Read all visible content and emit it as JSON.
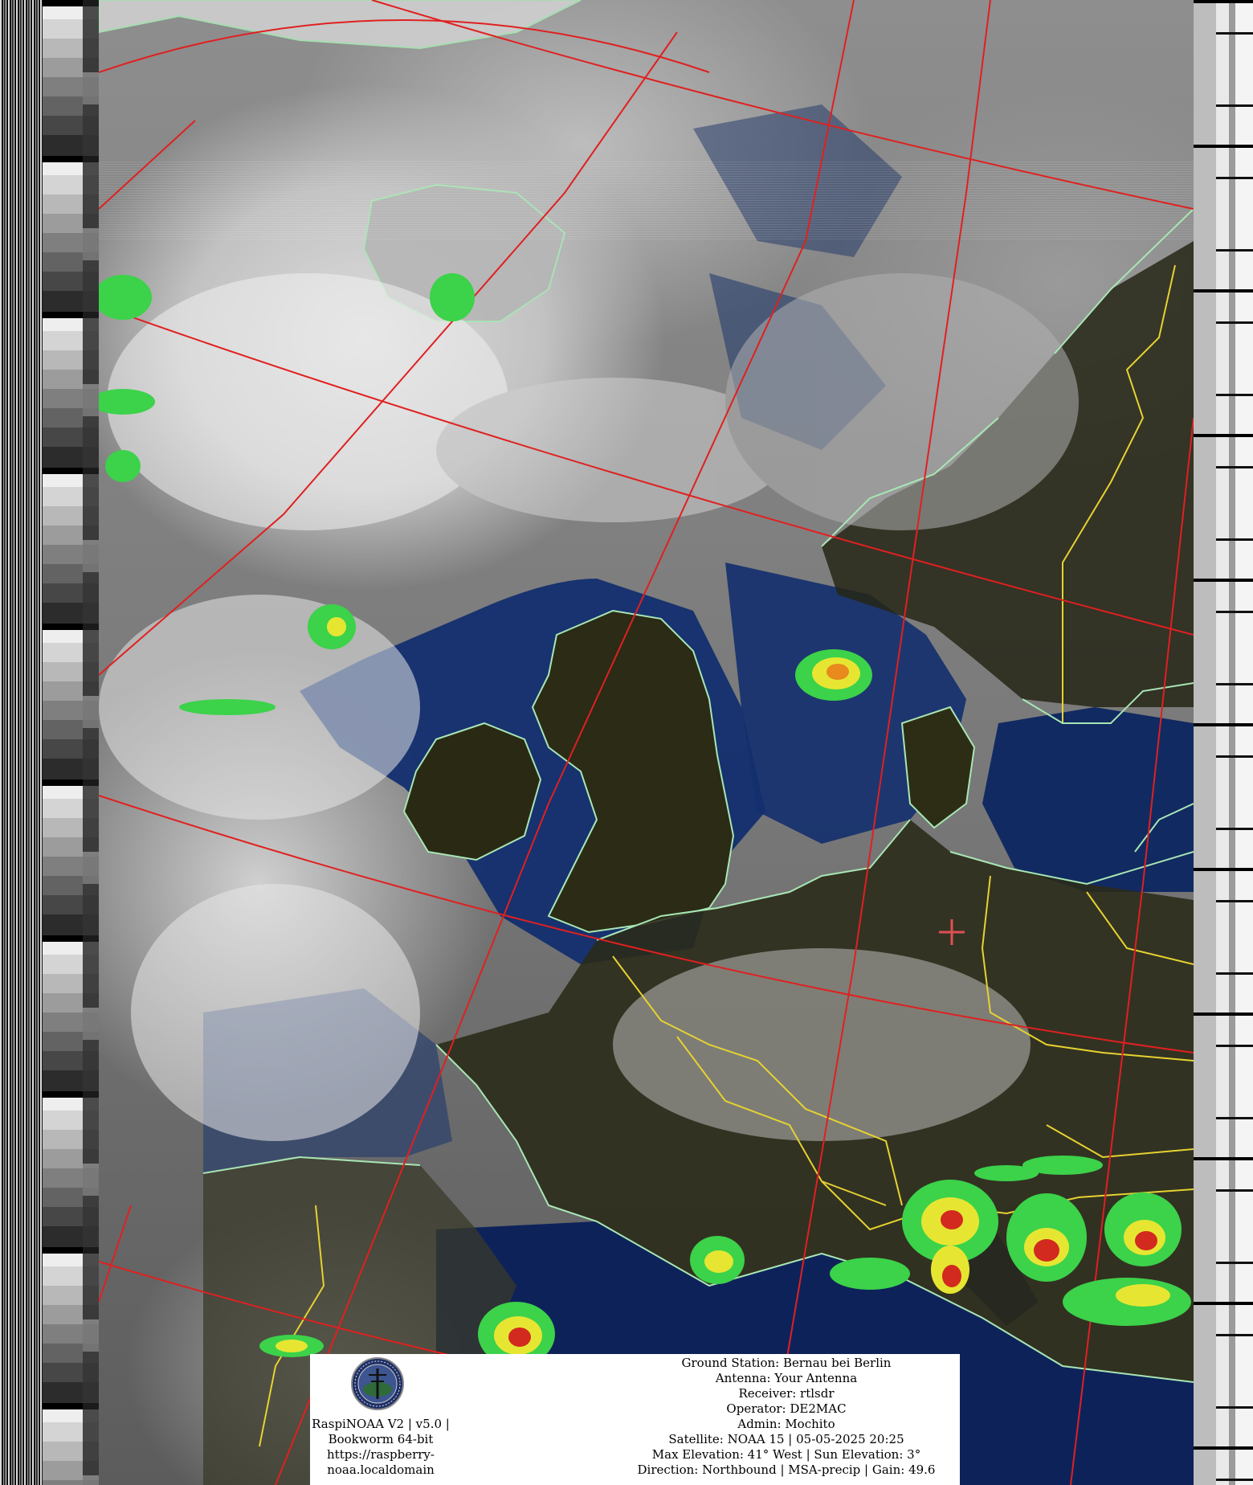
{
  "image": {
    "subject": "NOAA 15 APT weather satellite image of Western Europe with MSA-precip enhancement",
    "colors": {
      "grid_lines": "#e02020",
      "coastlines": "#a8e6b4",
      "borders": "#e6d230",
      "sea": "#0d2a66",
      "land": "#2a2a12",
      "precip_light": "#3cd24a",
      "precip_medium": "#e6e632",
      "precip_heavy": "#d22a1e",
      "station_marker": "#e05050"
    }
  },
  "footer": {
    "logo_name": "raspinoaa-logo",
    "project_lines": [
      "RaspiNOAA V2 | v5.0 |",
      "Bookworm 64-bit",
      "https://raspberry-",
      "noaa.localdomain"
    ],
    "pass_info": [
      "Ground Station: Bernau bei Berlin",
      "Antenna: Your Antenna",
      "Receiver: rtlsdr",
      "Operator: DE2MAC",
      "Admin: Mochito",
      "Satellite: NOAA 15 | 05-05-2025 20:25",
      "Max Elevation: 41° West | Sun Elevation: 3°",
      "Direction: Northbound | MSA-precip | Gain: 49.6"
    ]
  }
}
